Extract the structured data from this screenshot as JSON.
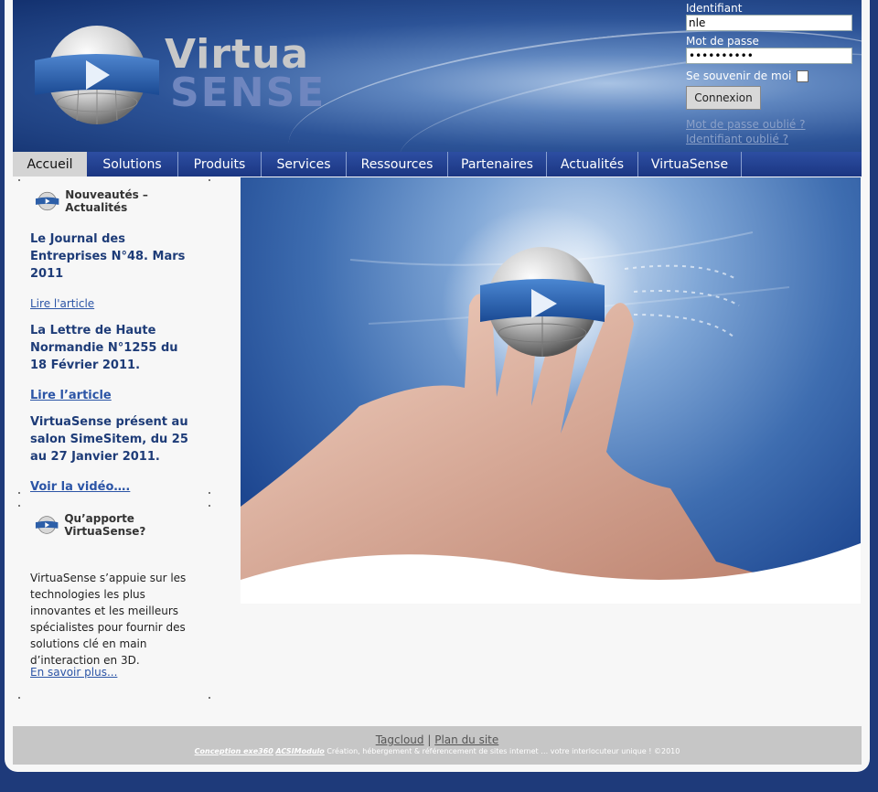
{
  "logo": {
    "part1": "Virtua",
    "part2": "SENSE"
  },
  "login": {
    "identifiant_label": "Identifiant",
    "identifiant_value": "nle",
    "password_label": "Mot de passe",
    "password_value": "••••••••••",
    "remember_label": "Se souvenir de moi",
    "submit_label": "Connexion",
    "forgot_password": "Mot de passe oublié ?",
    "forgot_login": "Identifiant oublié ?"
  },
  "nav": {
    "items": [
      {
        "label": "Accueil"
      },
      {
        "label": "Solutions"
      },
      {
        "label": "Produits"
      },
      {
        "label": "Services"
      },
      {
        "label": "Ressources"
      },
      {
        "label": "Partenaires"
      },
      {
        "label": "Actualités"
      },
      {
        "label": "VirtuaSense"
      }
    ]
  },
  "sidebar": {
    "news_heading": "Nouveautés – Actualités",
    "news": [
      {
        "title": "Le Journal des Entreprises N°48. Mars 2011",
        "link": "Lire l'article"
      },
      {
        "title": "La Lettre de Haute Normandie N°1255 du 18 Février 2011.",
        "link": "Lire l’article"
      },
      {
        "title": "VirtuaSense présent au salon SimeSitem, du 25 au 27 Janvier 2011.",
        "link": "Voir la vidéo…."
      }
    ],
    "about_heading": "Qu’apporte VirtuaSense?",
    "about_text": "VirtuaSense s’appuie sur les technologies les plus innovantes et les meilleurs spécialistes pour fournir des solutions clé en main d’interaction en 3D.",
    "about_link": "En savoir plus..."
  },
  "footer": {
    "tagcloud": "Tagcloud",
    "separator": "|",
    "sitemap": "Plan du site",
    "credit1": "Conception exe360",
    "credit2": "ACSIModulo",
    "credit_text": "Création, hébergement & référencement de sites internet … votre interlocuteur unique ! ©2010"
  },
  "colors": {
    "accent": "#2d4ea2",
    "title_blue": "#1e3c78",
    "link_blue": "#2c55a6"
  }
}
